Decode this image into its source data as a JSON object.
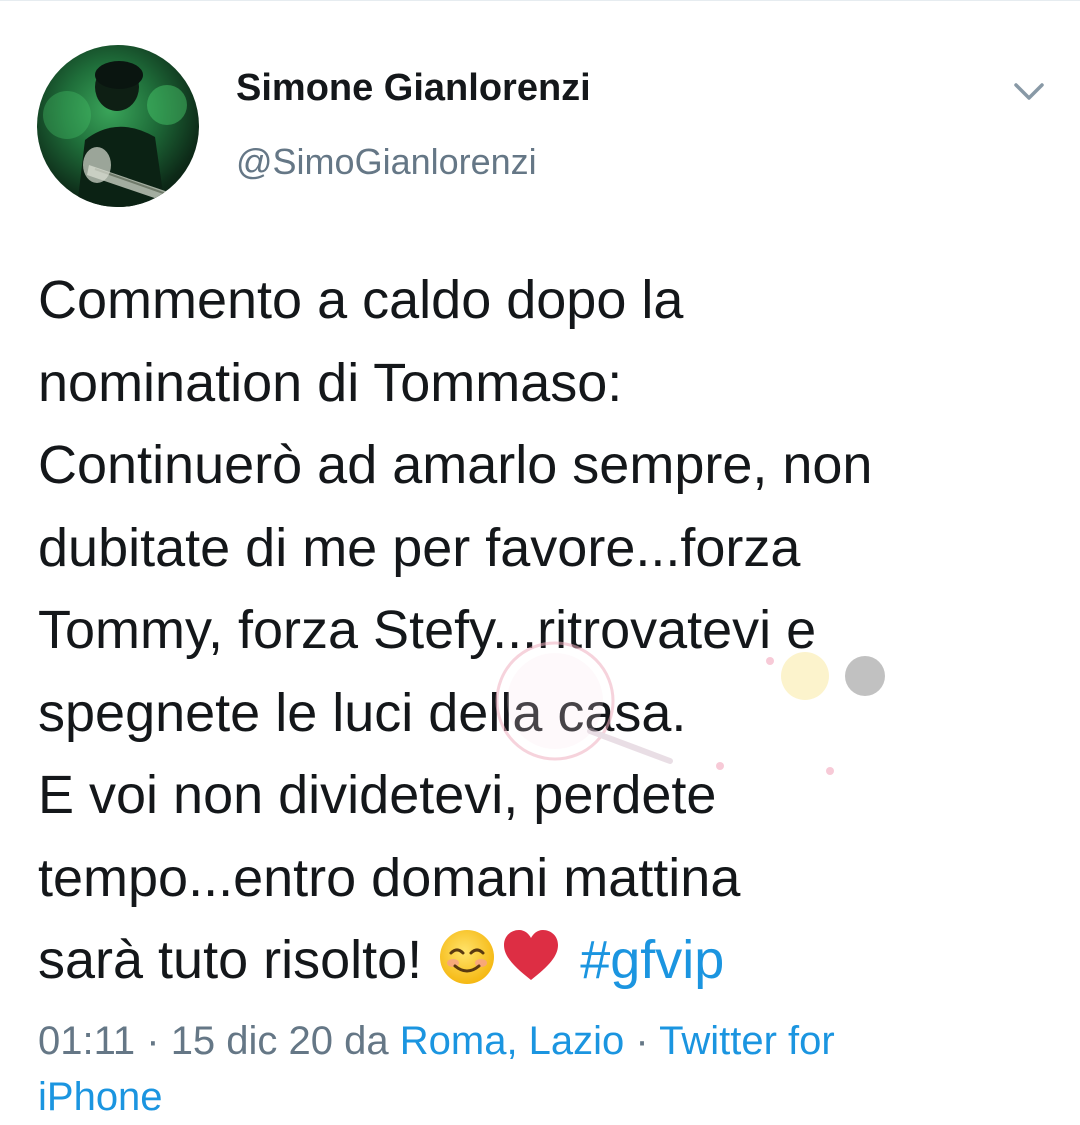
{
  "author": {
    "display_name": "Simone Gianlorenzi",
    "handle": "@SimoGianlorenzi",
    "avatar_icon": "profile-photo"
  },
  "menu": {
    "caret_icon": "chevron-down-icon"
  },
  "tweet": {
    "lines": [
      "Commento a caldo dopo la",
      "nomination di Tommaso:",
      "Continuerò ad amarlo sempre, non",
      "dubitate di me per favore...forza",
      "Tommy, forza Stefy...ritrovatevi e",
      "spegnete le luci della casa.",
      "E voi non dividetevi, perdete",
      "tempo...entro domani mattina",
      "sarà tuto risolto! "
    ],
    "emojis": [
      "smiling-face-with-smiling-eyes",
      "red-heart"
    ],
    "hashtag": "#gfvip",
    "hashtag_color": "#1b95e0"
  },
  "meta": {
    "time": "01:11",
    "separator": " · ",
    "date": "15 dic 20",
    "da": " da ",
    "location": "Roma, Lazio",
    "source_line1": "Twitter for",
    "source_line2": "iPhone"
  },
  "colors": {
    "text": "#14171a",
    "secondary": "#657786",
    "link": "#1b95e0"
  }
}
